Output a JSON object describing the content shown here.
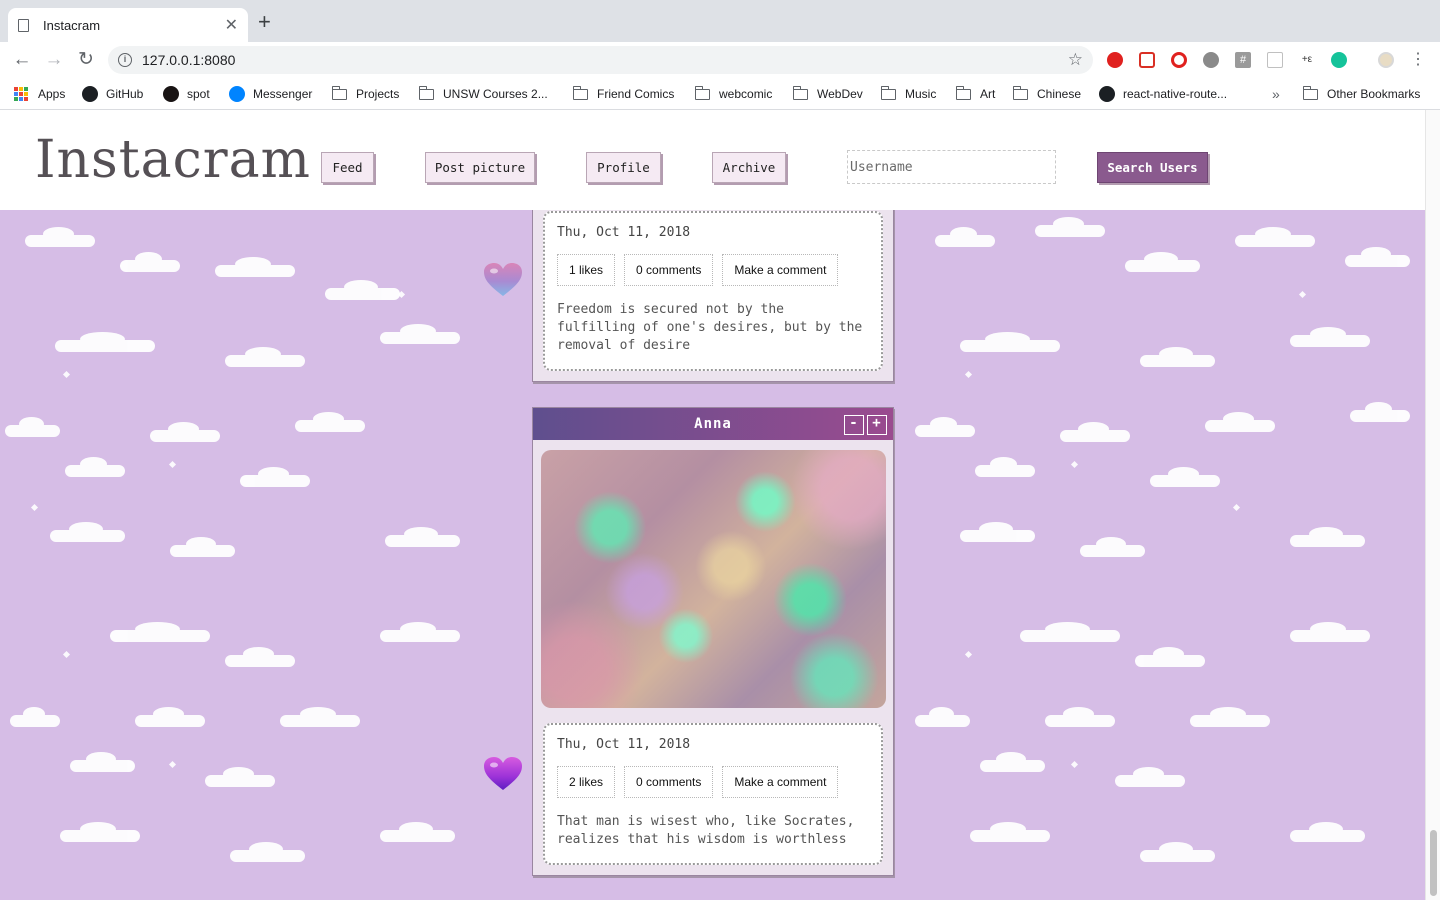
{
  "browser": {
    "tab_title": "Instacram",
    "url": "127.0.0.1:8080",
    "bookmarks": [
      {
        "label": "Apps",
        "icon": "apps-grid-icon"
      },
      {
        "label": "GitHub",
        "icon": "github-icon"
      },
      {
        "label": "spot",
        "icon": "spotify-icon"
      },
      {
        "label": "Messenger",
        "icon": "messenger-icon"
      },
      {
        "label": "Projects",
        "icon": "folder-icon"
      },
      {
        "label": "UNSW Courses 2...",
        "icon": "folder-icon"
      },
      {
        "label": "Friend Comics",
        "icon": "folder-icon"
      },
      {
        "label": "webcomic",
        "icon": "folder-icon"
      },
      {
        "label": "WebDev",
        "icon": "folder-icon"
      },
      {
        "label": "Music",
        "icon": "folder-icon"
      },
      {
        "label": "Art",
        "icon": "folder-icon"
      },
      {
        "label": "Chinese",
        "icon": "folder-icon"
      },
      {
        "label": "react-native-route...",
        "icon": "github-icon"
      }
    ],
    "overflow_label": "»",
    "other_bookmarks": "Other Bookmarks"
  },
  "app": {
    "logo": "Instacram",
    "nav": {
      "feed": "Feed",
      "post_picture": "Post picture",
      "profile": "Profile",
      "archive": "Archive"
    },
    "search": {
      "placeholder": "Username",
      "button": "Search Users"
    }
  },
  "posts": [
    {
      "author": "",
      "date": "Thu, Oct 11, 2018",
      "likes": "1 likes",
      "comments": "0 comments",
      "comment_action": "Make a comment",
      "caption": "Freedom is secured not by the fulfilling of one's desires, but by the removal of desire",
      "liked": false
    },
    {
      "author": "Anna",
      "minimize": "-",
      "expand": "+",
      "date": "Thu, Oct 11, 2018",
      "likes": "2 likes",
      "comments": "0 comments",
      "comment_action": "Make a comment",
      "caption": "That man is wisest who, like Socrates, realizes that his wisdom is worthless",
      "liked": true
    }
  ],
  "colors": {
    "background": "#d6bde6",
    "accent": "#8a5a8e",
    "post_bar_start": "#5f4f8e",
    "post_bar_end": "#9a4b8f"
  }
}
